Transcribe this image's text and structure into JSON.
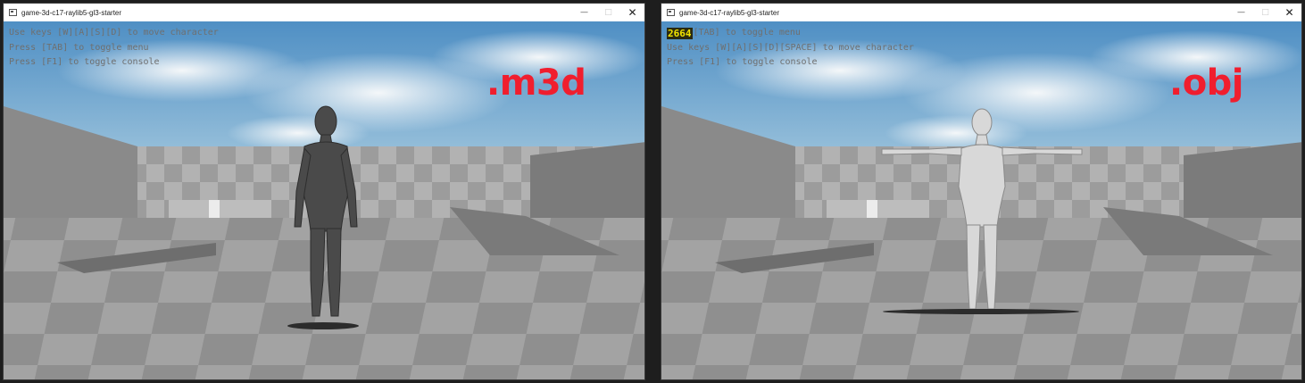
{
  "windows": [
    {
      "title": "game-3d-c17-raylib5-gl3-starter",
      "minimize_icon": "minimize-icon",
      "maximize_icon": "maximize-icon",
      "close_icon": "close-icon",
      "overlay": [
        "Use keys [W][A][S][D] to move character",
        "Press [TAB] to toggle menu",
        "Press [F1] to toggle console"
      ],
      "format_label": ".m3d",
      "format_color": "#f01e2e"
    },
    {
      "title": "game-3d-c17-raylib5-gl3-starter",
      "fps": "2664",
      "fps_color": "#f2e300",
      "overlay": [
        "[TAB] to toggle menu",
        "Use keys [W][A][S][D][SPACE] to move character",
        "Press [F1] to toggle console"
      ],
      "format_label": ".obj",
      "format_color": "#f01e2e"
    }
  ]
}
